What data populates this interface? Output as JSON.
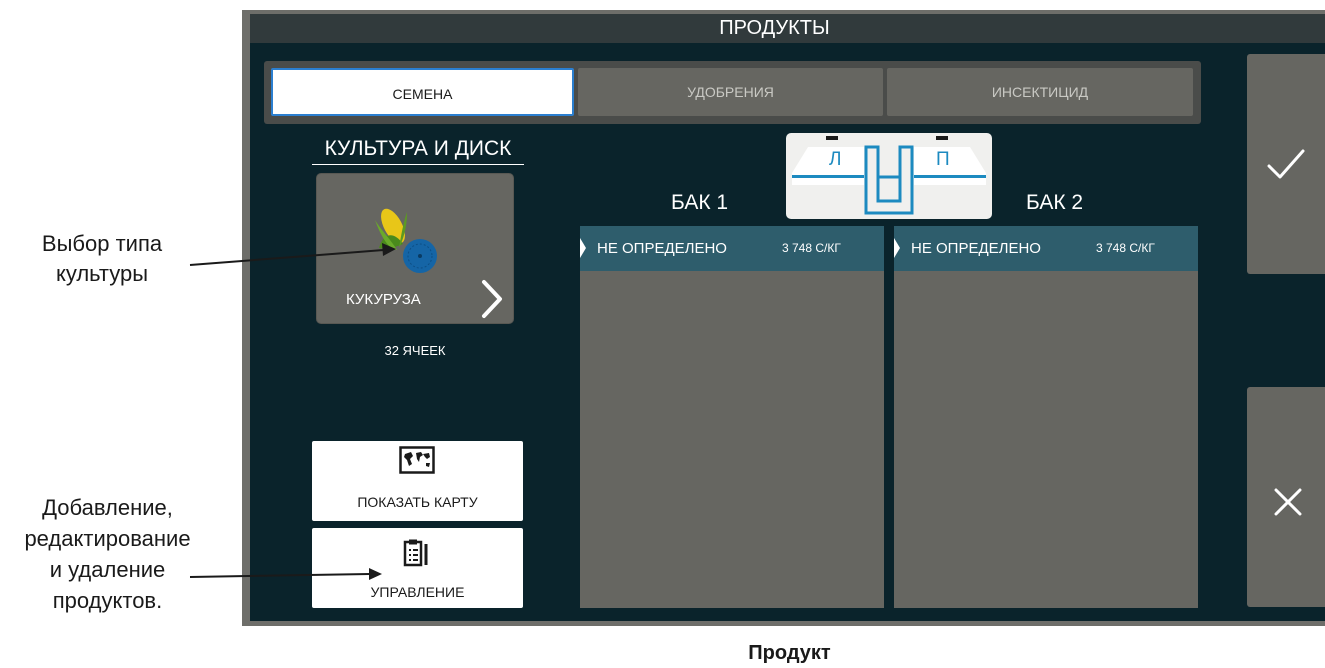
{
  "screen": {
    "title": "ПРОДУКТЫ",
    "tabs": [
      {
        "label": "СЕМЕНА",
        "active": true
      },
      {
        "label": "УДОБРЕНИЯ",
        "active": false
      },
      {
        "label": "ИНСЕКТИЦИД",
        "active": false
      }
    ],
    "crop": {
      "heading": "КУЛЬТУРА И ДИСК",
      "name": "КУКУРУЗА",
      "cells": "32 ЯЧЕЕК"
    },
    "buttons": {
      "show_map": "ПОКАЗАТЬ КАРТУ",
      "manage": "УПРАВЛЕНИЕ"
    },
    "diagram": {
      "left": "Л",
      "right": "П"
    },
    "tanks": [
      {
        "label": "БАК 1",
        "product": "НЕ ОПРЕДЕЛЕНО",
        "rate": "3 748 С/КГ"
      },
      {
        "label": "БАК 2",
        "product": "НЕ ОПРЕДЕЛЕНО",
        "rate": "3 748 С/КГ"
      }
    ],
    "icons": {
      "confirm": "check-icon",
      "cancel": "close-icon",
      "map": "world-map-icon",
      "manage": "clipboard-list-icon",
      "crop": "corn-icon"
    }
  },
  "annotations": {
    "crop_type": [
      "Выбор типа",
      "культуры"
    ],
    "manage_products": [
      "Добавление,",
      "редактирование",
      "и удаление",
      "продуктов."
    ]
  },
  "caption": "Продукт",
  "colors": {
    "screen_bg": "#0a232b",
    "panel_gray": "#666661",
    "panel_header": "#2e5d6c",
    "active_tab_border": "#2b7fd0",
    "tank_diagram_blue": "#1c8ac0"
  }
}
